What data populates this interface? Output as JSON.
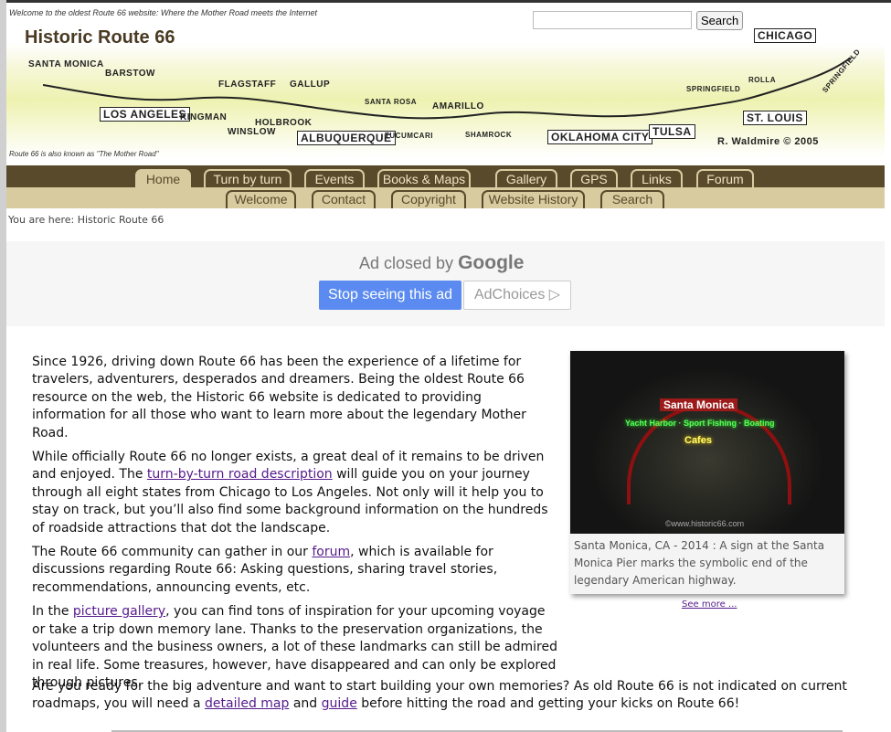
{
  "header": {
    "tagline": "Welcome to the oldest Route 66 website: Where the Mother Road meets the Internet",
    "title": "Historic Route 66",
    "subtag": "Route 66 is also known as \"The Mother Road\"",
    "search_button": "Search",
    "search_value": "",
    "map_towns": [
      "Santa Monica",
      "Barstow",
      "Los Angeles",
      "Kingman",
      "Flagstaff",
      "Gallup",
      "Holbrook",
      "Winslow",
      "Albuquerque",
      "Santa Rosa",
      "Tucumcari",
      "Amarillo",
      "Shamrock",
      "Oklahoma City",
      "Tulsa",
      "Springfield",
      "Rolla",
      "St. Louis",
      "Chicago",
      "Springfield"
    ],
    "map_signature": "R. Waldmire © 2005"
  },
  "nav": {
    "main": [
      "Home",
      "Turn by turn",
      "Events",
      "Books & Maps",
      "Gallery",
      "GPS",
      "Links",
      "Forum"
    ],
    "sub": [
      "Welcome",
      "Contact",
      "Copyright",
      "Website History",
      "Search"
    ]
  },
  "breadcrumb": "You are here: Historic Route 66",
  "ad": {
    "closed_prefix": "Ad closed by",
    "closed_brand": "Google",
    "stop": "Stop seeing this ad",
    "choices": "AdChoices ▷"
  },
  "content": {
    "p1": "Since 1926, driving down Route 66 has been the experience of a lifetime for travelers, adventurers, desperados and dreamers. Being the oldest Route 66 resource on the web, the Historic 66 website is dedicated to providing information for all those who want to learn more about the legendary Mother Road.",
    "p2a": "While officially Route 66 no longer exists, a great deal of it remains to be driven and enjoyed. The ",
    "p2link": "turn-by-turn road description",
    "p2b": " will guide you on your journey through all eight states from Chicago to Los Angeles. Not only will it help you to stay on track, but you’ll also find some background information on the hundreds of roadside attractions that dot the landscape.",
    "p3a": "The Route 66 community can gather in our ",
    "p3link": "forum",
    "p3b": ", which is available for discussions regarding Route 66: Asking questions, sharing travel stories, recommendations, announcing events, etc.",
    "p4a": "In the ",
    "p4link": "picture gallery",
    "p4b": ", you can find tons of inspiration for your upcoming voyage or take a trip down memory lane. Thanks to the preservation organizations, the volunteers and the business owners, a lot of these landmarks can still be admired in real life. Some treasures, however, have disappeared and can only be explored through pictures.",
    "p5a": "Are you ready for the big adventure and want to start building your own memories? As old Route 66 is not indicated on current roadmaps, you will need a ",
    "p5link1": "detailed map",
    "p5mid": " and ",
    "p5link2": "guide",
    "p5b": " before hitting the road and getting your kicks on Route 66!"
  },
  "figure": {
    "sign_top": "Santa Monica",
    "sign_mid": "Yacht Harbor · Sport Fishing · Boating",
    "sign_low": "Cafes",
    "watermark": "©www.historic66.com",
    "caption": "Santa Monica, CA - 2014 : A sign at the Santa Monica Pier marks the symbolic end of the legendary American highway.",
    "see_more": "See more ..."
  }
}
